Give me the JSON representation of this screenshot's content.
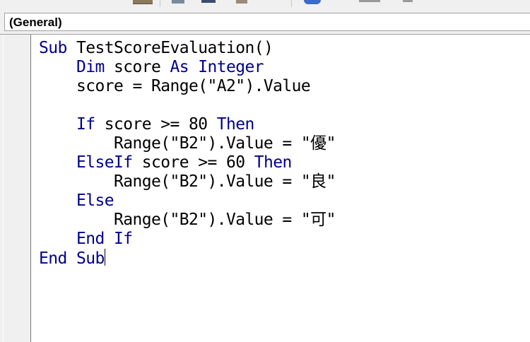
{
  "object_dropdown": {
    "value": "(General)"
  },
  "code_lines": [
    [
      {
        "t": "Sub",
        "k": true
      },
      {
        "t": " TestScoreEvaluation()",
        "k": false
      }
    ],
    [
      {
        "t": "    ",
        "k": false
      },
      {
        "t": "Dim",
        "k": true
      },
      {
        "t": " score ",
        "k": false
      },
      {
        "t": "As",
        "k": true
      },
      {
        "t": " ",
        "k": false
      },
      {
        "t": "Integer",
        "k": true
      }
    ],
    [
      {
        "t": "    score = Range(\"A2\").Value",
        "k": false
      }
    ],
    [],
    [
      {
        "t": "    ",
        "k": false
      },
      {
        "t": "If",
        "k": true
      },
      {
        "t": " score >= 80 ",
        "k": false
      },
      {
        "t": "Then",
        "k": true
      }
    ],
    [
      {
        "t": "        Range(\"B2\").Value = \"優\"",
        "k": false
      }
    ],
    [
      {
        "t": "    ",
        "k": false
      },
      {
        "t": "ElseIf",
        "k": true
      },
      {
        "t": " score >= 60 ",
        "k": false
      },
      {
        "t": "Then",
        "k": true
      }
    ],
    [
      {
        "t": "        Range(\"B2\").Value = \"良\"",
        "k": false
      }
    ],
    [
      {
        "t": "    ",
        "k": false
      },
      {
        "t": "Else",
        "k": true
      }
    ],
    [
      {
        "t": "        Range(\"B2\").Value = \"可\"",
        "k": false
      }
    ],
    [
      {
        "t": "    ",
        "k": false
      },
      {
        "t": "End If",
        "k": true
      }
    ],
    [
      {
        "t": "End Sub",
        "k": true
      }
    ]
  ],
  "colors": {
    "keyword": "#00008b",
    "identifier": "#000000",
    "margin": "#f0f0f0",
    "editor_background": "#ffffff"
  }
}
